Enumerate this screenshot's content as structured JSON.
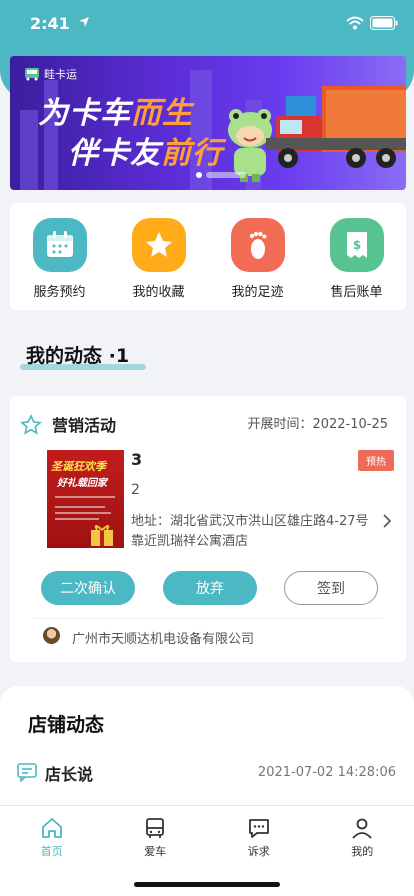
{
  "status_bar": {
    "time": "2:41"
  },
  "banner": {
    "logo_text": "畦卡运",
    "slogan_1_a": "为卡车",
    "slogan_1_b": "而生",
    "slogan_2_a": "伴卡友",
    "slogan_2_b": "前行"
  },
  "quick_menu": [
    {
      "label": "服务预约",
      "icon": "calendar-icon",
      "color": "#4cb8c4"
    },
    {
      "label": "我的收藏",
      "icon": "star-icon",
      "color": "#ffab1a"
    },
    {
      "label": "我的足迹",
      "icon": "footprint-icon",
      "color": "#f26c55"
    },
    {
      "label": "售后账单",
      "icon": "bill-icon",
      "color": "#57c391"
    }
  ],
  "my_activity": {
    "heading": "我的动态 ·1",
    "card": {
      "title": "营销活动",
      "date_label": "开展时间：2022-10-25",
      "image_text_1": "圣诞狂欢季",
      "image_text_2": "好礼载回家",
      "name": "3",
      "subtitle": "2",
      "badge": "预热",
      "address": "地址：湖北省武汉市洪山区雄庄路4-27号靠近凯瑞祥公寓酒店",
      "btn_confirm": "二次确认",
      "btn_abandon": "放弃",
      "btn_checkin": "签到",
      "company": "广州市天顺达机电设备有限公司"
    }
  },
  "store": {
    "heading": "店铺动态",
    "post_title": "店长说",
    "post_time": "2021-07-02 14:28:06"
  },
  "tab_bar": [
    {
      "label": "首页",
      "icon": "home-icon",
      "active": true
    },
    {
      "label": "爱车",
      "icon": "bus-icon",
      "active": false
    },
    {
      "label": "诉求",
      "icon": "chat-icon",
      "active": false
    },
    {
      "label": "我的",
      "icon": "profile-icon",
      "active": false
    }
  ],
  "colors": {
    "accent": "#4cb8c4",
    "badge": "#f06a5a"
  }
}
